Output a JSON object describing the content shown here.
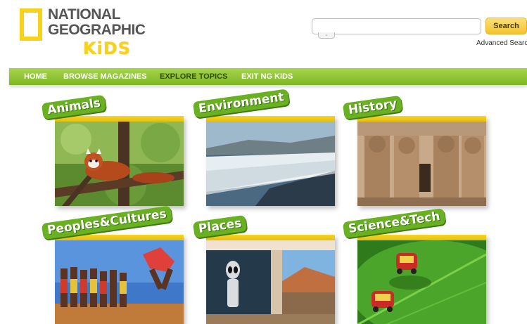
{
  "logo": {
    "line1": "NATIONAL",
    "line2": "GEOGRAPHIC",
    "kids": "KiDS"
  },
  "search": {
    "placeholder": "",
    "value": "",
    "button_label": "Search",
    "advanced_label": "Advanced Search"
  },
  "nav": {
    "items": [
      {
        "label": "HOME"
      },
      {
        "label": "BROWSE MAGAZINES"
      },
      {
        "label": "EXPLORE TOPICS",
        "active": true
      },
      {
        "label": "EXIT NG KIDS"
      }
    ]
  },
  "topics": [
    {
      "label": "Animals",
      "image": "red-panda-in-tree"
    },
    {
      "label": "Environment",
      "image": "glacier-landscape"
    },
    {
      "label": "History",
      "image": "abu-simbel-statues"
    },
    {
      "label": "Peoples&Cultures",
      "image": "jumping-dancers"
    },
    {
      "label": "Places",
      "image": "alien-statue-building"
    },
    {
      "label": "Science&Tech",
      "image": "robot-cars-on-leaf"
    }
  ],
  "colors": {
    "nav_green": "#8cc63f",
    "label_green": "#6ab023",
    "accent_yellow": "#f6d21b"
  }
}
